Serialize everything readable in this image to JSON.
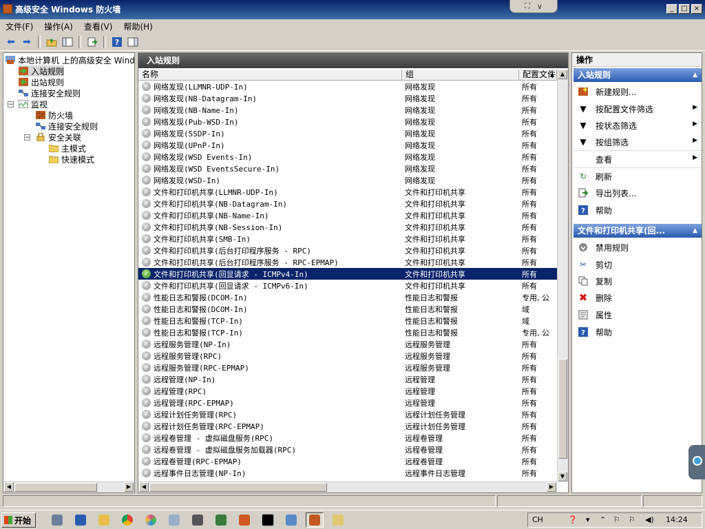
{
  "window": {
    "title": "高级安全 Windows 防火墙",
    "min": "_",
    "max": "□",
    "close": "×",
    "rdp_pin": "⛶",
    "rdp_collapse": "∨"
  },
  "menubar": [
    "文件(F)",
    "操作(A)",
    "查看(V)",
    "帮助(H)"
  ],
  "tree": {
    "root": "本地计算机 上的高级安全 Windows",
    "inbound": "入站规则",
    "outbound": "出站规则",
    "conn_sec": "连接安全规则",
    "monitor": "监视",
    "firewall": "防火墙",
    "monitor_conn_sec": "连接安全规则",
    "sec_assoc": "安全关联",
    "main_mode": "主模式",
    "quick_mode": "快速模式"
  },
  "main": {
    "title": "入站规则",
    "columns": [
      "名称",
      "组",
      "配置文件"
    ],
    "selected_index": 16,
    "rows": [
      {
        "name": "网络发现(LLMNR-UDP-In)",
        "group": "网络发现",
        "profile": "所有"
      },
      {
        "name": "网络发现(NB-Datagram-In)",
        "group": "网络发现",
        "profile": "所有"
      },
      {
        "name": "网络发现(NB-Name-In)",
        "group": "网络发现",
        "profile": "所有"
      },
      {
        "name": "网络发现(Pub-WSD-In)",
        "group": "网络发现",
        "profile": "所有"
      },
      {
        "name": "网络发现(SSDP-In)",
        "group": "网络发现",
        "profile": "所有"
      },
      {
        "name": "网络发现(UPnP-In)",
        "group": "网络发现",
        "profile": "所有"
      },
      {
        "name": "网络发现(WSD Events-In)",
        "group": "网络发现",
        "profile": "所有"
      },
      {
        "name": "网络发现(WSD EventsSecure-In)",
        "group": "网络发现",
        "profile": "所有"
      },
      {
        "name": "网络发现(WSD-In)",
        "group": "网络发现",
        "profile": "所有"
      },
      {
        "name": "文件和打印机共享(LLMNR-UDP-In)",
        "group": "文件和打印机共享",
        "profile": "所有"
      },
      {
        "name": "文件和打印机共享(NB-Datagram-In)",
        "group": "文件和打印机共享",
        "profile": "所有"
      },
      {
        "name": "文件和打印机共享(NB-Name-In)",
        "group": "文件和打印机共享",
        "profile": "所有"
      },
      {
        "name": "文件和打印机共享(NB-Session-In)",
        "group": "文件和打印机共享",
        "profile": "所有"
      },
      {
        "name": "文件和打印机共享(SMB-In)",
        "group": "文件和打印机共享",
        "profile": "所有"
      },
      {
        "name": "文件和打印机共享(后台打印程序服务 - RPC)",
        "group": "文件和打印机共享",
        "profile": "所有"
      },
      {
        "name": "文件和打印机共享(后台打印程序服务 - RPC-EPMAP)",
        "group": "文件和打印机共享",
        "profile": "所有"
      },
      {
        "name": "文件和打印机共享(回显请求 - ICMPv4-In)",
        "group": "文件和打印机共享",
        "profile": "所有"
      },
      {
        "name": "文件和打印机共享(回显请求 - ICMPv6-In)",
        "group": "文件和打印机共享",
        "profile": "所有"
      },
      {
        "name": "性能日志和警报(DCOM-In)",
        "group": "性能日志和警报",
        "profile": "专用, 公"
      },
      {
        "name": "性能日志和警报(DCOM-In)",
        "group": "性能日志和警报",
        "profile": "域"
      },
      {
        "name": "性能日志和警报(TCP-In)",
        "group": "性能日志和警报",
        "profile": "域"
      },
      {
        "name": "性能日志和警报(TCP-In)",
        "group": "性能日志和警报",
        "profile": "专用, 公"
      },
      {
        "name": "远程服务管理(NP-In)",
        "group": "远程服务管理",
        "profile": "所有"
      },
      {
        "name": "远程服务管理(RPC)",
        "group": "远程服务管理",
        "profile": "所有"
      },
      {
        "name": "远程服务管理(RPC-EPMAP)",
        "group": "远程服务管理",
        "profile": "所有"
      },
      {
        "name": "远程管理(NP-In)",
        "group": "远程管理",
        "profile": "所有"
      },
      {
        "name": "远程管理(RPC)",
        "group": "远程管理",
        "profile": "所有"
      },
      {
        "name": "远程管理(RPC-EPMAP)",
        "group": "远程管理",
        "profile": "所有"
      },
      {
        "name": "远程计划任务管理(RPC)",
        "group": "远程计划任务管理",
        "profile": "所有"
      },
      {
        "name": "远程计划任务管理(RPC-EPMAP)",
        "group": "远程计划任务管理",
        "profile": "所有"
      },
      {
        "name": "远程卷管理 - 虚拟磁盘服务(RPC)",
        "group": "远程卷管理",
        "profile": "所有"
      },
      {
        "name": "远程卷管理 - 虚拟磁盘服务加载器(RPC)",
        "group": "远程卷管理",
        "profile": "所有"
      },
      {
        "name": "远程卷管理(RPC-EPMAP)",
        "group": "远程卷管理",
        "profile": "所有"
      },
      {
        "name": "远程事件日志管理(NP-In)",
        "group": "远程事件日志管理",
        "profile": "所有"
      }
    ]
  },
  "actions": {
    "title": "操作",
    "section1": "入站规则",
    "section1_items": {
      "new_rule": "新建规则...",
      "filter_profile": "按配置文件筛选",
      "filter_state": "按状态筛选",
      "filter_group": "按组筛选",
      "view": "查看",
      "refresh": "刷新",
      "export": "导出列表...",
      "help": "帮助"
    },
    "section2": "文件和打印机共享(回...",
    "section2_items": {
      "disable": "禁用规则",
      "cut": "剪切",
      "copy": "复制",
      "delete": "删除",
      "properties": "属性",
      "help": "帮助"
    }
  },
  "taskbar": {
    "start": "开始",
    "lang": "CH",
    "clock": "14:24"
  }
}
